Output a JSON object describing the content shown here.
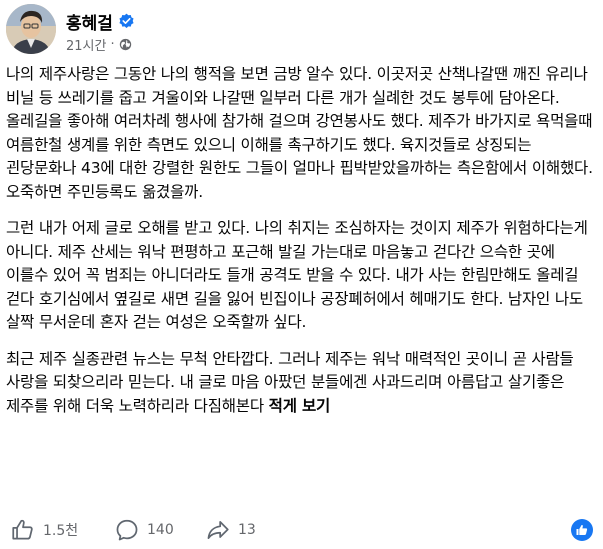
{
  "post": {
    "author": "홍혜걸",
    "time": "21시간",
    "dot": "·",
    "paragraphs": [
      "나의 제주사랑은 그동안 나의 행적을 보면 금방 알수 있다. 이곳저곳 산책나갈땐 깨진 유리나 비닐 등 쓰레기를 줍고 겨울이와 나갈땐 일부러 다른 개가 실례한 것도 봉투에 담아온다. 올레길을 좋아해 여러차례 행사에 참가해 걸으며 강연봉사도 했다. 제주가 바가지로 욕먹을때 여름한철 생계를 위한 측면도 있으니 이해를 촉구하기도 했다. 육지것들로 상징되는 괸당문화나 43에 대한 강렬한 원한도 그들이 얼마나 핍박받았을까하는 측은함에서 이해했다. 오죽하면 주민등록도 옮겼을까.",
      "그런 내가 어제 글로 오해를 받고 있다. 나의 취지는 조심하자는 것이지 제주가 위험하다는게 아니다. 제주 산세는 워낙 편평하고 포근해 발길 가는대로 마음놓고 걷다간 으슥한 곳에 이를수 있어 꼭 범죄는 아니더라도 들개 공격도 받을 수 있다. 내가 사는 한림만해도 올레길 걷다 호기심에서 옆길로 새면 길을 잃어 빈집이나 공장폐허에서 헤매기도 한다. 남자인 나도 살짝 무서운데 혼자 걷는 여성은 오죽할까 싶다.",
      "최근 제주 실종관련 뉴스는 무척 안타깝다. 그러나 제주는 워낙 매력적인 곳이니 곧 사람들 사랑을 되찾으리라 믿는다. 내 글로 마음 아팠던 분들에겐 사과드리며 아름답고 살기좋은 제주를 위해 더욱 노력하리라 다짐해본다 "
    ],
    "see_more": "적게 보기",
    "likes": "1.5천",
    "comments": "140",
    "shares": "13"
  },
  "icons": [
    "verified-badge-icon",
    "globe-icon",
    "like-icon",
    "comment-icon",
    "share-icon",
    "messenger-like-icon"
  ],
  "colors": {
    "verified": "#1877f2",
    "meta": "#65676b",
    "text": "#050505"
  }
}
